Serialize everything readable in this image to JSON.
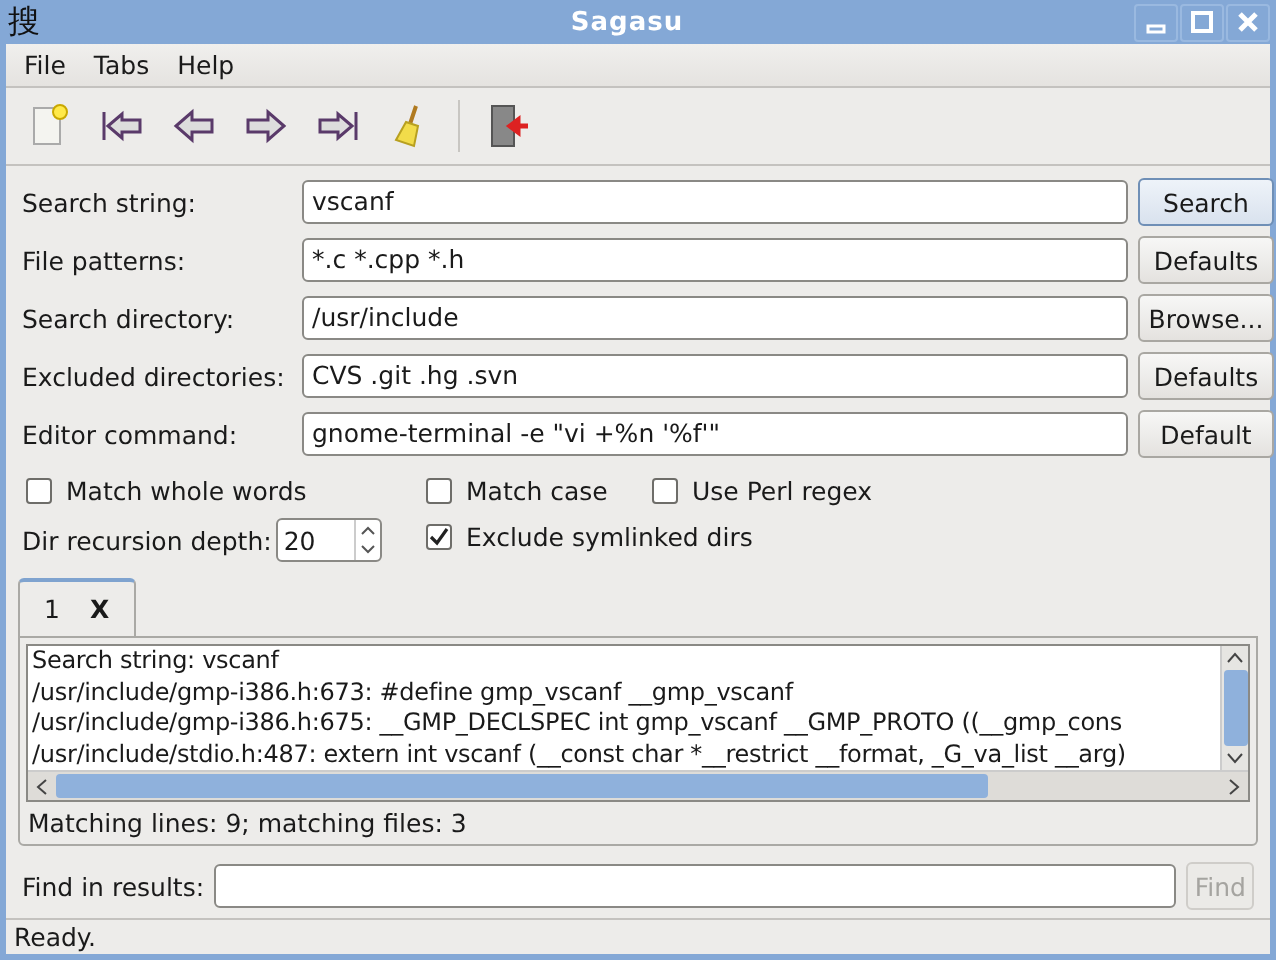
{
  "window": {
    "icon_glyph": "搜",
    "title": "Sagasu"
  },
  "menu": [
    "File",
    "Tabs",
    "Help"
  ],
  "form": [
    {
      "label": "Search string:",
      "value": "vscanf",
      "button": "Search",
      "default": true
    },
    {
      "label": "File patterns:",
      "value": "*.c *.cpp *.h",
      "button": "Defaults",
      "default": false
    },
    {
      "label": "Search directory:",
      "value": "/usr/include",
      "button": "Browse...",
      "default": false
    },
    {
      "label": "Excluded directories:",
      "value": "CVS .git .hg .svn",
      "button": "Defaults",
      "default": false
    },
    {
      "label": "Editor command:",
      "value": "gnome-terminal -e \"vi +%n '%f'\"",
      "button": "Default",
      "default": false
    }
  ],
  "options": [
    {
      "label": "Match whole words",
      "checked": false
    },
    {
      "label": "Match case",
      "checked": false
    },
    {
      "label": "Use Perl regex",
      "checked": false
    },
    {
      "label": "Exclude symlinked dirs",
      "checked": true
    }
  ],
  "recursion": {
    "label": "Dir recursion depth:",
    "value": "20"
  },
  "tabs": [
    {
      "label": "1",
      "close": "X",
      "selected": true
    }
  ],
  "results": [
    "Search string: vscanf",
    "/usr/include/gmp-i386.h:673: #define gmp_vscanf __gmp_vscanf",
    "/usr/include/gmp-i386.h:675: __GMP_DECLSPEC int gmp_vscanf __GMP_PROTO ((__gmp_cons",
    "/usr/include/stdio.h:487: extern int vscanf (__const char *__restrict __format, _G_va_list __arg)"
  ],
  "summary": "Matching lines: 9; matching files: 3",
  "find": {
    "label": "Find in results:",
    "button": "Find",
    "disabled": true
  },
  "status_bar": "Ready."
}
